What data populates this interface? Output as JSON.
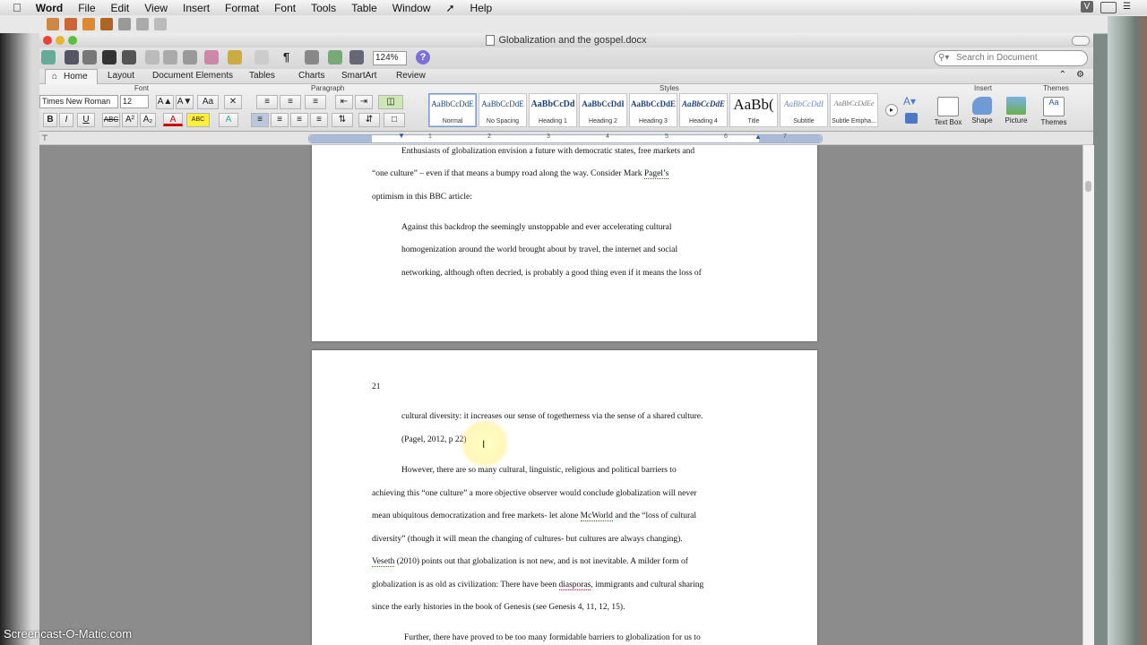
{
  "menubar": {
    "app": "Word",
    "items": [
      "File",
      "Edit",
      "View",
      "Insert",
      "Format",
      "Font",
      "Tools",
      "Table",
      "Window",
      "Help"
    ]
  },
  "window": {
    "title": "Globalization and the gospel.docx"
  },
  "toolbar": {
    "zoom": "124%",
    "search_placeholder": "Search in Document"
  },
  "ribbon": {
    "tabs": [
      "Home",
      "Layout",
      "Document Elements",
      "Tables",
      "Charts",
      "SmartArt",
      "Review"
    ],
    "active_tab": "Home",
    "groups": {
      "font": "Font",
      "paragraph": "Paragraph",
      "styles": "Styles",
      "insert": "Insert",
      "themes": "Themes"
    },
    "font_name": "Times New Roman",
    "font_size": "12",
    "styles": [
      {
        "preview": "AaBbCcDdE",
        "name": "Normal"
      },
      {
        "preview": "AaBbCcDdE",
        "name": "No Spacing"
      },
      {
        "preview": "AaBbCcDd",
        "name": "Heading 1"
      },
      {
        "preview": "AaBbCcDdI",
        "name": "Heading 2"
      },
      {
        "preview": "AaBbCcDdE",
        "name": "Heading 3"
      },
      {
        "preview": "AaBbCcDdE",
        "name": "Heading 4"
      },
      {
        "preview": "AaBb(",
        "name": "Title"
      },
      {
        "preview": "AaBbCcDdI",
        "name": "Subtitle"
      },
      {
        "preview": "AaBbCcDdEe",
        "name": "Subtle Empha..."
      }
    ],
    "insert_items": [
      "Text Box",
      "Shape",
      "Picture",
      "Themes"
    ]
  },
  "ruler": {
    "numbers": [
      "1",
      "2",
      "3",
      "4",
      "5",
      "6",
      "7"
    ]
  },
  "document": {
    "page1_lines": [
      "Enthusiasts of globalization envision a future with democratic states, free markets and",
      "“one culture” – even if that means a bumpy road along the way. Consider Mark ",
      "Pagel’s",
      "optimism in this BBC article:",
      "Against this backdrop the seemingly unstoppable and ever accelerating cultural",
      "homogenization around the world brought about by travel, the internet and social",
      "networking, although often decried, is probably a good thing even if it means the loss of"
    ],
    "page_number": "21",
    "page2_lines": [
      "cultural diversity: it increases our sense of togetherness via the sense of a shared culture.",
      "(Pagel, 2012, p 22)",
      "However, there are so many cultural, linguistic, religious and political barriers to",
      "achieving this “one culture” a more objective observer would conclude globalization will never",
      "mean ubiquitous democratization and free markets- let alone ",
      "McWorld",
      " and the “loss of cultural",
      "diversity” (though it will mean the changing of cultures- but cultures are always changing).",
      "Veseth",
      " (2010) points out that globalization is not new, and is not inevitable. A milder form of",
      "globalization is as old as civilization: There have been ",
      "diasporas",
      ", immigrants and cultural sharing",
      "since the early histories in the book of Genesis (see Genesis 4, 11, 12, 15).",
      "Further, there have proved to be too many formidable barriers to globalization for us to"
    ]
  },
  "watermark": "Screencast-O-Matic.com",
  "colors": {
    "ribbon_bg": "#e6e6e6",
    "doc_bg": "#8c8c8c",
    "spell_underline": "#d02020",
    "highlight_circle": "#ffe83c"
  }
}
